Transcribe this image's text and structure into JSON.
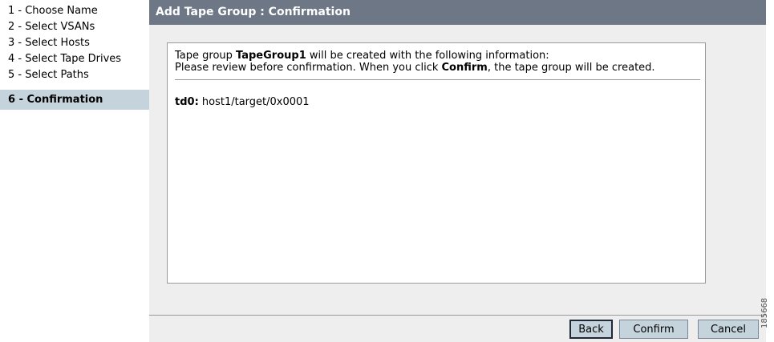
{
  "steps": [
    {
      "label": "1 - Choose Name"
    },
    {
      "label": "2 - Select VSANs"
    },
    {
      "label": "3 - Select Hosts"
    },
    {
      "label": "4 - Select Tape Drives"
    },
    {
      "label": "5 - Select Paths"
    },
    {
      "label": "6 - Confirmation"
    }
  ],
  "header": {
    "title": "Add Tape Group : Confirmation"
  },
  "info": {
    "line1_prefix": "Tape group ",
    "group_name": "TapeGroup1",
    "line1_suffix": " will be created with the following information:",
    "line2_prefix": "Please review before confirmation. When you click ",
    "confirm_word": "Confirm",
    "line2_suffix": ", the tape group will be created."
  },
  "entry": {
    "key": "td0:",
    "value": " host1/target/0x0001"
  },
  "buttons": {
    "back": "Back",
    "confirm": "Confirm",
    "cancel": "Cancel"
  },
  "figure_id": "185668",
  "colors": {
    "header_bg": "#6e7786",
    "active_step_bg": "#c5d3dc",
    "button_bg": "#c5d3dc",
    "panel_bg": "#eeeeee"
  }
}
